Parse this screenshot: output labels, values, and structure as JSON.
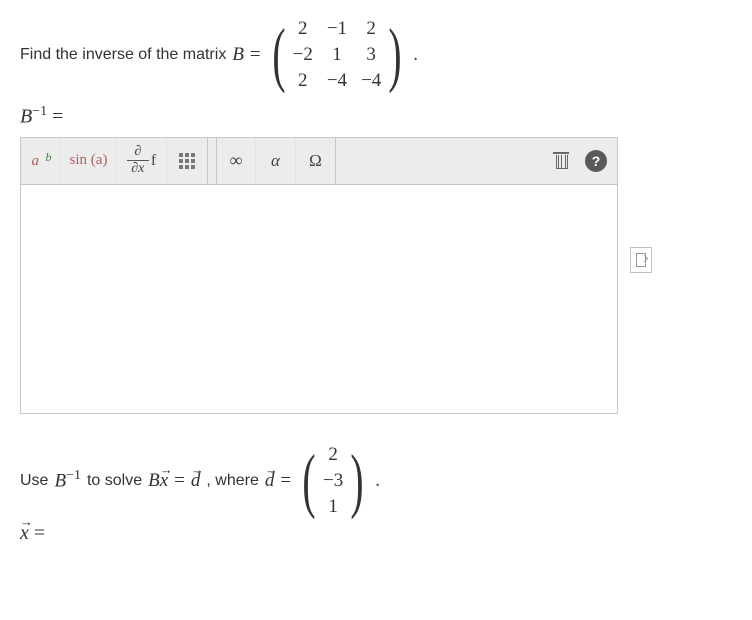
{
  "problem1": {
    "prompt": "Find the inverse of the matrix",
    "matrix_var": "B",
    "equals": "=",
    "matrix": {
      "r1c1": "2",
      "r1c2": "−1",
      "r1c3": "2",
      "r2c1": "−2",
      "r2c2": "1",
      "r2c3": "3",
      "r3c1": "2",
      "r3c2": "−4",
      "r3c3": "−4"
    },
    "dot": ".",
    "answer_label_B": "B",
    "answer_label_exp": "−1",
    "answer_label_eq": "="
  },
  "toolbar": {
    "ab_a": "a",
    "ab_b": "b",
    "sin": "sin (a)",
    "partial_num": "∂",
    "partial_den": "∂x",
    "partial_f": "f",
    "infinity": "∞",
    "alpha": "α",
    "omega": "Ω",
    "help": "?"
  },
  "problem2": {
    "prefix": "Use",
    "B": "B",
    "exp": "−1",
    "mid": "to solve",
    "Bx_B": "B",
    "Bx_x": "x",
    "eq1": "=",
    "d": "d",
    "comma": ", where",
    "d2": "d",
    "eq2": "=",
    "vec": {
      "v1": "2",
      "v2": "−3",
      "v3": "1"
    },
    "dot": ".",
    "answer_x": "x",
    "answer_eq": "="
  }
}
